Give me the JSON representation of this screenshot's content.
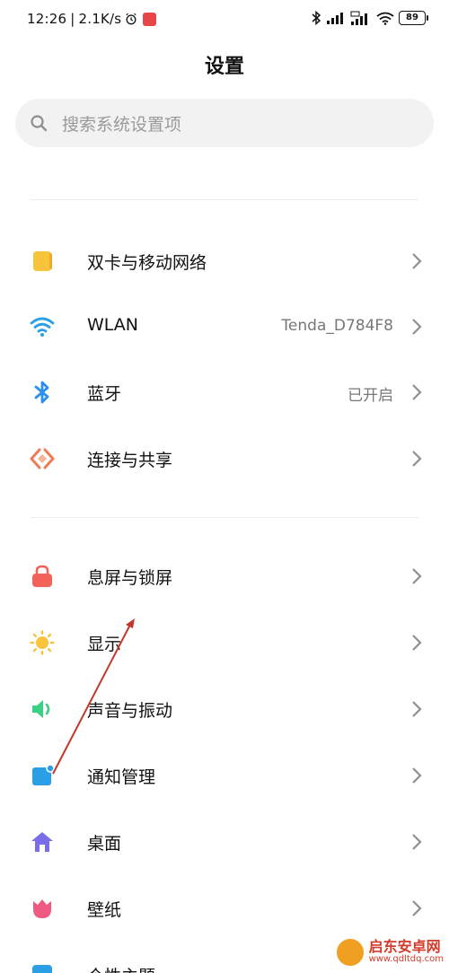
{
  "status_bar": {
    "time": "12:26",
    "separator": "|",
    "speed": "2.1K/s",
    "battery": "89"
  },
  "page_title": "设置",
  "search": {
    "placeholder": "搜索系统设置项"
  },
  "section1": [
    {
      "id": "dual-sim",
      "label": "双卡与移动网络",
      "value": "",
      "icon": "sim-card-icon",
      "color": "#f7c43b"
    },
    {
      "id": "wlan",
      "label": "WLAN",
      "value": "Tenda_D784F8",
      "icon": "wifi-icon",
      "color": "#2b9fe6"
    },
    {
      "id": "bluetooth",
      "label": "蓝牙",
      "value": "已开启",
      "icon": "bluetooth-icon",
      "color": "#2b8ff0"
    },
    {
      "id": "connection-sharing",
      "label": "连接与共享",
      "value": "",
      "icon": "connection-share-icon",
      "color": "#ef7a55"
    }
  ],
  "section2": [
    {
      "id": "lock-screen",
      "label": "息屏与锁屏",
      "value": "",
      "icon": "lock-icon",
      "color": "#f2645a"
    },
    {
      "id": "display",
      "label": "显示",
      "value": "",
      "icon": "sun-icon",
      "color": "#f7c43b"
    },
    {
      "id": "sound",
      "label": "声音与振动",
      "value": "",
      "icon": "speaker-icon",
      "color": "#3ccf86"
    },
    {
      "id": "notifications",
      "label": "通知管理",
      "value": "",
      "icon": "notification-icon",
      "color": "#2b9fe6"
    },
    {
      "id": "home-screen",
      "label": "桌面",
      "value": "",
      "icon": "home-icon",
      "color": "#7a6ee8"
    },
    {
      "id": "wallpaper",
      "label": "壁纸",
      "value": "",
      "icon": "tulip-icon",
      "color": "#ef5a83"
    },
    {
      "id": "themes",
      "label": "个性主题",
      "value": "",
      "icon": "theme-icon",
      "color": "#2b9fe6"
    }
  ],
  "watermark": {
    "name": "启东安卓网",
    "url": "www.qdltdq.com"
  },
  "colors": {
    "annotation_arrow": "#c0392b",
    "chevron": "#9a9a9a"
  }
}
